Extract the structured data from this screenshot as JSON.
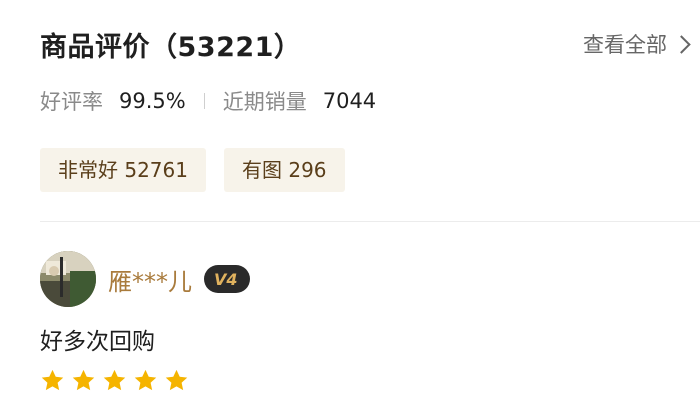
{
  "header": {
    "title": "商品评价（53221）",
    "view_all_label": "查看全部"
  },
  "stats": {
    "good_rate_label": "好评率",
    "good_rate_value": "99.5%",
    "recent_sales_label": "近期销量",
    "recent_sales_value": "7044"
  },
  "tags": [
    {
      "label": "非常好 52761"
    },
    {
      "label": "有图 296"
    }
  ],
  "review": {
    "username": "雁***儿",
    "vip_level": "V4",
    "text": "好多次回购",
    "rating": 5,
    "max_rating": 5
  },
  "colors": {
    "star": "#f5b400",
    "username": "#a97b3c",
    "tag_bg": "#f7f3ea",
    "tag_text": "#5a3e1a",
    "vip_badge": "#2a2a2a",
    "vip_text": "#e0b25e"
  }
}
